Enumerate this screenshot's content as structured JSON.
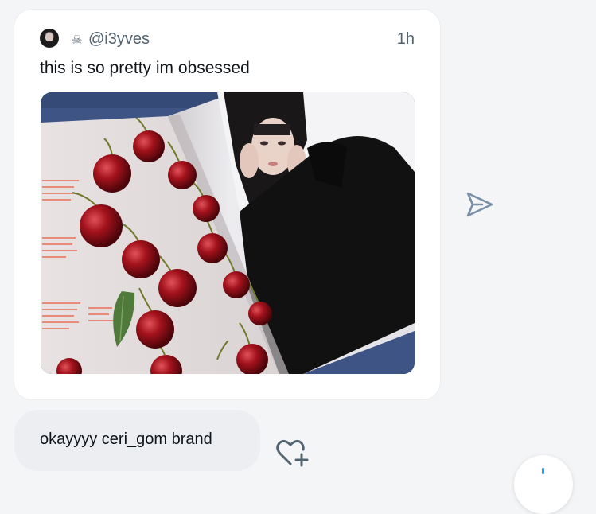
{
  "post": {
    "skull_glyph": "☠",
    "handle": "@i3yves",
    "time": "1h",
    "text": "this is so pretty im obsessed",
    "image_icon": "photo-magazine-cherries"
  },
  "icons": {
    "send": "send-icon",
    "react": "heart-plus-icon",
    "compose": "compose-button"
  },
  "reply": {
    "text": "okayyyy ceri_gom brand"
  },
  "colors": {
    "muted": "#536471",
    "send_icon": "#7a8fa6",
    "bubble_bg": "#eceef1",
    "accent": "#1d9bf0"
  }
}
